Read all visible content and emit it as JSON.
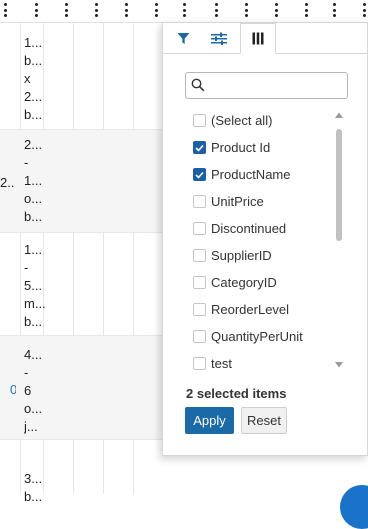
{
  "grid": {
    "rows": [
      {
        "text": "1...\nb...\nx\n2...\nb...",
        "left": ""
      },
      {
        "text": "2...\n-\n1...\no...\nb...",
        "left": "2..."
      },
      {
        "text": "1...\n-\n5...\nm...\nb...",
        "left": ""
      },
      {
        "text": "4...\n-\n6\no...\nj...",
        "left": "0"
      },
      {
        "text": "3...\nb...",
        "left": ""
      }
    ]
  },
  "popup": {
    "tabs": [
      {
        "name": "filter-icon"
      },
      {
        "name": "sliders-icon"
      },
      {
        "name": "columns-icon"
      }
    ],
    "search": {
      "placeholder": "",
      "value": ""
    },
    "items": [
      {
        "label": "(Select all)",
        "checked": false
      },
      {
        "label": "Product Id",
        "checked": true
      },
      {
        "label": "ProductName",
        "checked": true
      },
      {
        "label": "UnitPrice",
        "checked": false
      },
      {
        "label": "Discontinued",
        "checked": false
      },
      {
        "label": "SupplierID",
        "checked": false
      },
      {
        "label": "CategoryID",
        "checked": false
      },
      {
        "label": "ReorderLevel",
        "checked": false
      },
      {
        "label": "QuantityPerUnit",
        "checked": false
      },
      {
        "label": "test",
        "checked": false
      }
    ],
    "selected_count": "2 selected items",
    "apply_label": "Apply",
    "reset_label": "Reset"
  },
  "colors": {
    "accent": "#1a6aa8",
    "checkbox_checked": "#1a5fa8",
    "link_blue": "#1a73c8"
  }
}
